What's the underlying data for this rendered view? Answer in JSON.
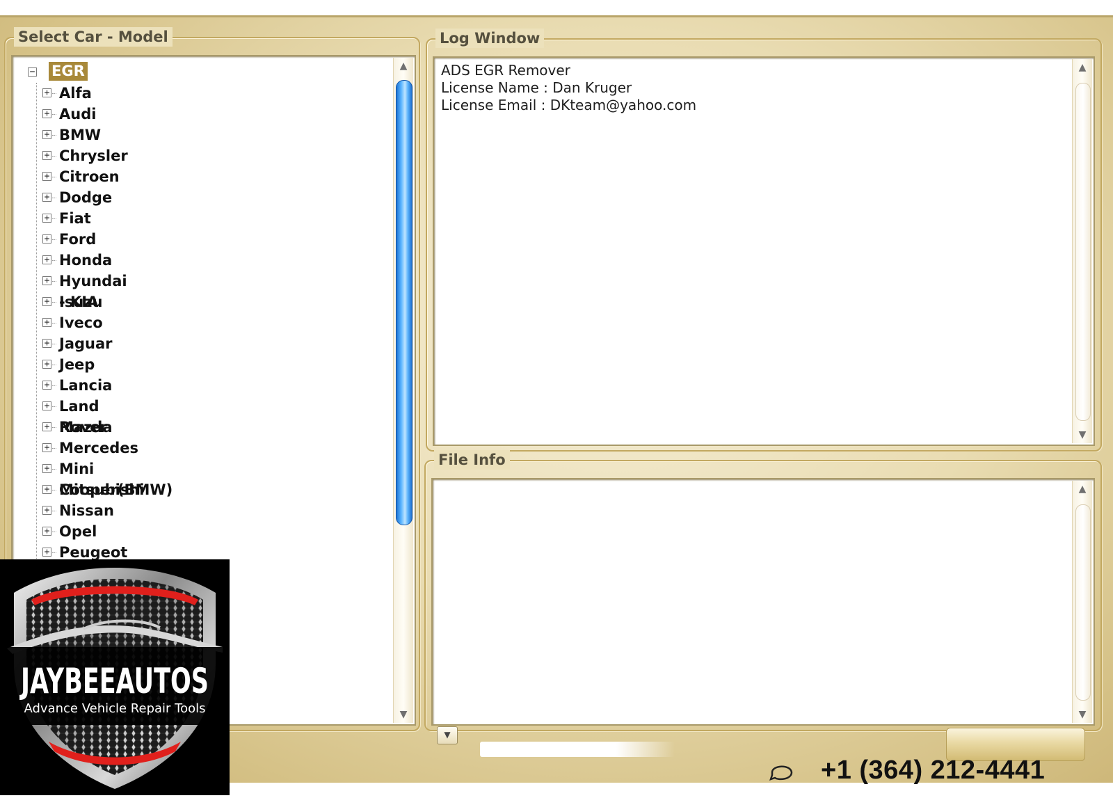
{
  "select_group": {
    "title": "Select Car - Model",
    "root_label": "EGR",
    "items": [
      {
        "label": "Alfa"
      },
      {
        "label": "Audi"
      },
      {
        "label": "BMW"
      },
      {
        "label": "Chrysler"
      },
      {
        "label": "Citroen"
      },
      {
        "label": "Dodge"
      },
      {
        "label": "Fiat"
      },
      {
        "label": "Ford"
      },
      {
        "label": "Honda"
      },
      {
        "label": "Hyundai - KIA"
      },
      {
        "label": "Isuzu"
      },
      {
        "label": "Iveco"
      },
      {
        "label": "Jaguar"
      },
      {
        "label": "Jeep"
      },
      {
        "label": "Lancia"
      },
      {
        "label": "Land Rover"
      },
      {
        "label": "Mazda"
      },
      {
        "label": "Mercedes"
      },
      {
        "label": "Mini Cooper(BMW)"
      },
      {
        "label": "Mitsubishi"
      },
      {
        "label": "Nissan"
      },
      {
        "label": "Opel"
      },
      {
        "label": "Peugeot"
      }
    ]
  },
  "log_group": {
    "title": "Log Window",
    "lines": [
      "ADS EGR Remover",
      "License Name : Dan Kruger",
      "License Email : DKteam@yahoo.com"
    ]
  },
  "file_group": {
    "title": "File Info"
  },
  "overlay": {
    "brand_name": "JAYBEEAUTOS",
    "tagline": "Advance Vehicle Repair Tools",
    "phone": "+1 (364) 212-4441"
  },
  "colors": {
    "frame_gold": "#d5c186",
    "selection": "#a8893a",
    "scroll_thumb": "#1f73d2",
    "logo_red": "#e0201c"
  }
}
